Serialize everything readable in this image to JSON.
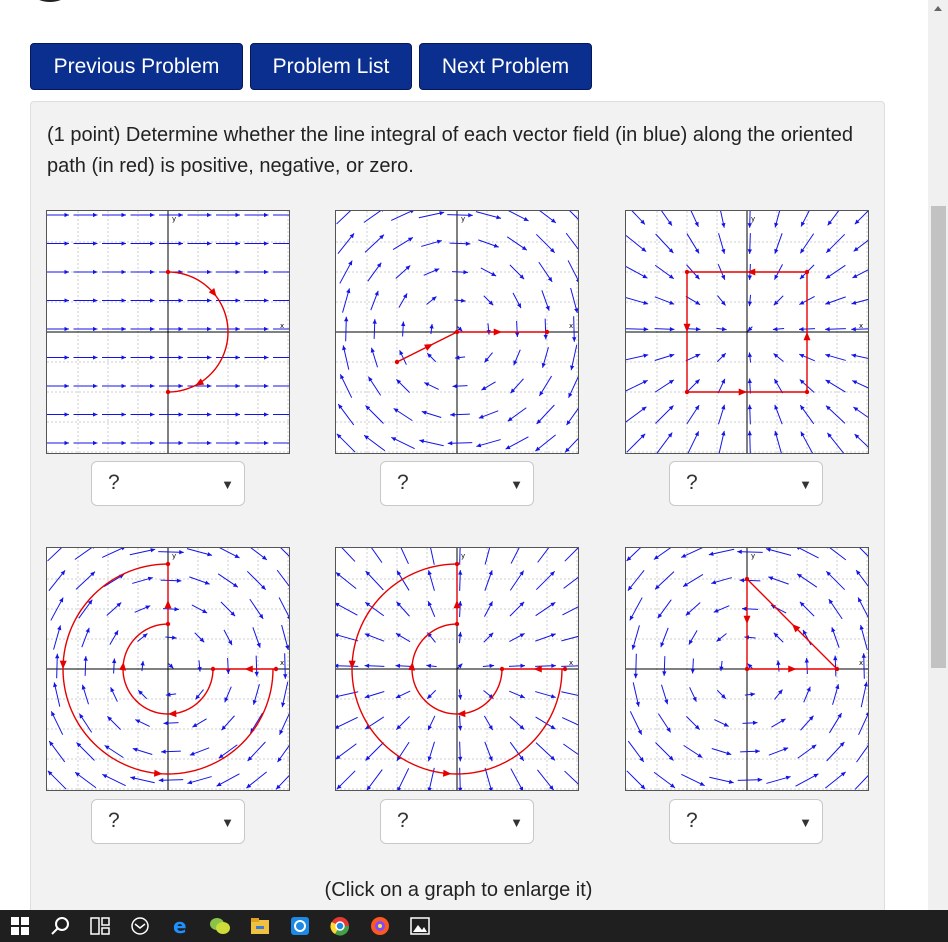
{
  "nav": {
    "previous_label": "Previous Problem",
    "list_label": "Problem List",
    "next_label": "Next Problem"
  },
  "problem": {
    "statement": "(1 point) Determine whether the line integral of each vector field (in blue) along the oriented path (in red) is positive, negative, or zero.",
    "hint": "(Click on a graph to enlarge it)"
  },
  "graph_labels": {
    "x": "x",
    "y": "y"
  },
  "colors": {
    "field": "#1414e6",
    "path": "#e60000",
    "nav_bg": "#0a2f8f"
  },
  "graphs": [
    {
      "field": "uniform-right",
      "path": "right-semicircle",
      "selected": "?"
    },
    {
      "field": "clockwise-rotation",
      "path": "broken-segment",
      "selected": "?"
    },
    {
      "field": "converging",
      "path": "square-loop",
      "selected": "?"
    },
    {
      "field": "clockwise-rotation",
      "path": "double-arc-spiral",
      "selected": "?"
    },
    {
      "field": "radial-outward",
      "path": "double-arc-spiral",
      "selected": "?"
    },
    {
      "field": "counterclockwise-rotation",
      "path": "triangle-loop",
      "selected": "?"
    }
  ],
  "taskbar": {
    "icons": [
      "windows-start-icon",
      "search-icon",
      "task-view-icon",
      "mail-icon",
      "edge-icon",
      "wechat-icon",
      "file-explorer-icon",
      "outlook-icon",
      "chrome-icon",
      "photo-app-icon",
      "photos-icon"
    ]
  }
}
